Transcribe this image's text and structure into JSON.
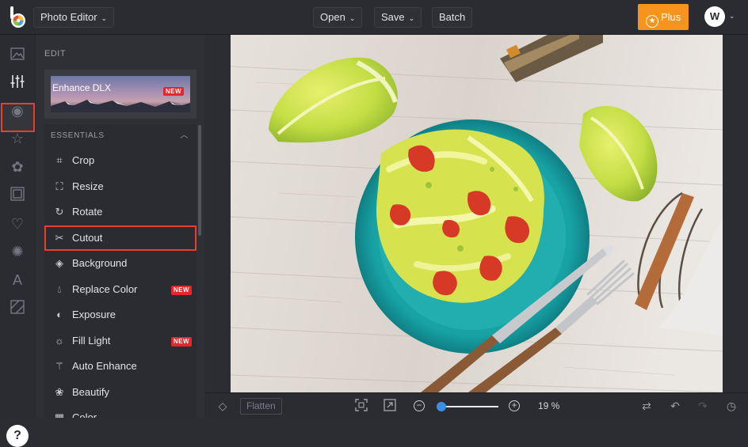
{
  "app": {
    "title": "Photo Editor",
    "menu": {
      "open": "Open",
      "save": "Save",
      "batch": "Batch"
    },
    "plus_label": "Plus",
    "avatar_initial": "W",
    "help": "?"
  },
  "panel": {
    "section_label": "EDIT",
    "enhance": {
      "label": "Enhance DLX",
      "badge": "NEW"
    },
    "essentials_label": "ESSENTIALS",
    "items": [
      {
        "label": "Crop",
        "icon": "crop-icon",
        "badge": ""
      },
      {
        "label": "Resize",
        "icon": "resize-icon",
        "badge": ""
      },
      {
        "label": "Rotate",
        "icon": "rotate-icon",
        "badge": ""
      },
      {
        "label": "Cutout",
        "icon": "scissors-icon",
        "badge": "",
        "selected": true
      },
      {
        "label": "Background",
        "icon": "background-icon",
        "badge": ""
      },
      {
        "label": "Replace Color",
        "icon": "drop-icon",
        "badge": "NEW"
      },
      {
        "label": "Exposure",
        "icon": "exposure-icon",
        "badge": ""
      },
      {
        "label": "Fill Light",
        "icon": "sun-icon",
        "badge": "NEW"
      },
      {
        "label": "Auto Enhance",
        "icon": "wand-icon",
        "badge": ""
      },
      {
        "label": "Beautify",
        "icon": "flower-icon",
        "badge": ""
      },
      {
        "label": "Color",
        "icon": "color-icon",
        "badge": ""
      }
    ]
  },
  "bottom": {
    "flatten": "Flatten",
    "zoom": "19 %",
    "zoom_level": 0.19
  },
  "colors": {
    "accent": "#f7941d",
    "highlight": "#e8402a",
    "badge": "#e0282e",
    "slider": "#3b8ee0"
  }
}
